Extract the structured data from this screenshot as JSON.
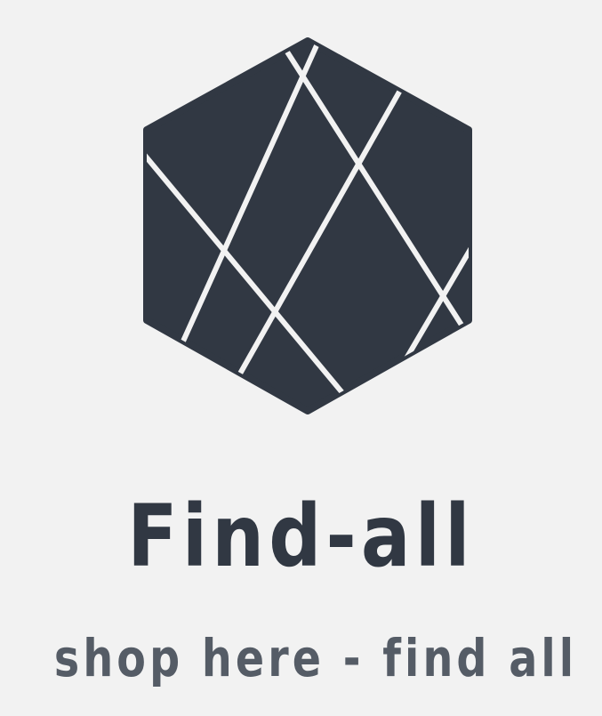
{
  "brand": {
    "name": "Find-all",
    "tagline": "shop here - find all",
    "logo_icon": "hexagon-geometric-lines-icon"
  },
  "colors": {
    "background": "#f2f2f2",
    "logo_fill": "#313843",
    "logo_lines": "#f2f2f2",
    "name_text": "#313843",
    "tagline_text": "#555c66"
  }
}
